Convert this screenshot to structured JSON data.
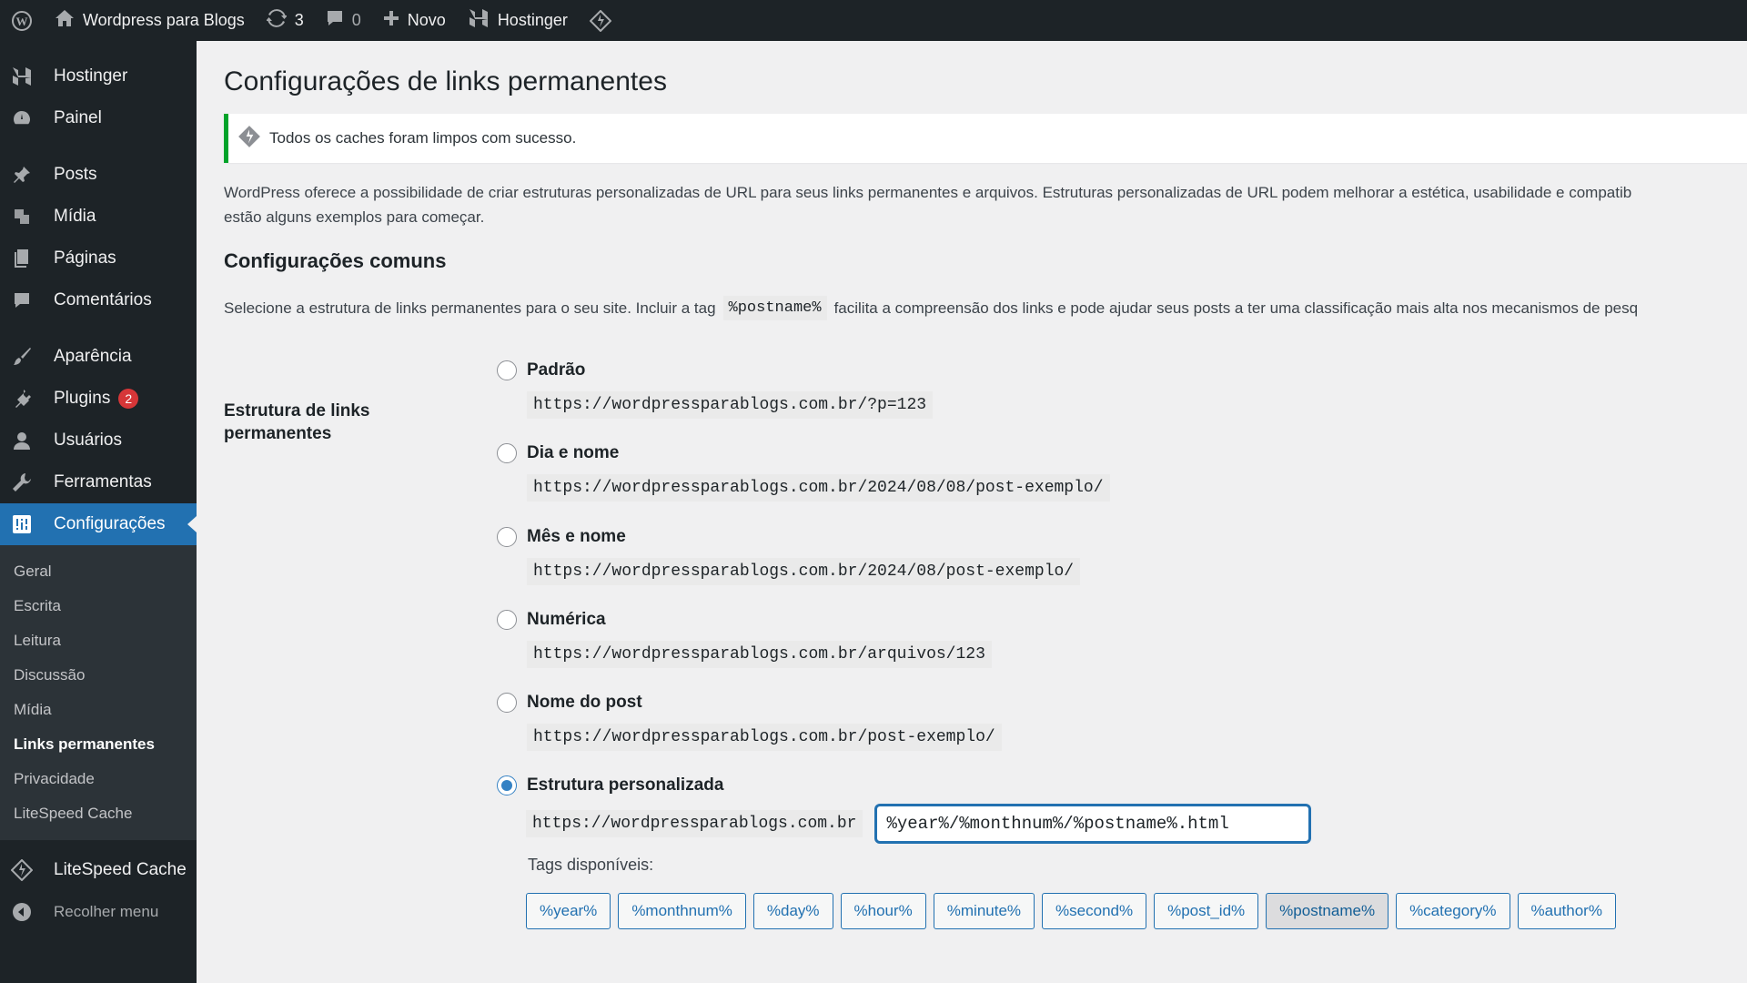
{
  "adminbar": {
    "site_name": "Wordpress para Blogs",
    "updates_count": "3",
    "comments_count": "0",
    "new_label": "Novo",
    "hostinger_label": "Hostinger"
  },
  "sidebar": {
    "items": [
      {
        "label": "Hostinger",
        "icon": "hostinger-icon"
      },
      {
        "label": "Painel",
        "icon": "dashboard-icon"
      },
      {
        "label": "Posts",
        "icon": "pin-icon"
      },
      {
        "label": "Mídia",
        "icon": "media-icon"
      },
      {
        "label": "Páginas",
        "icon": "page-icon"
      },
      {
        "label": "Comentários",
        "icon": "comment-icon"
      },
      {
        "label": "Aparência",
        "icon": "brush-icon"
      },
      {
        "label": "Plugins",
        "icon": "plugin-icon",
        "badge": "2"
      },
      {
        "label": "Usuários",
        "icon": "user-icon"
      },
      {
        "label": "Ferramentas",
        "icon": "wrench-icon"
      },
      {
        "label": "Configurações",
        "icon": "settings-icon"
      }
    ],
    "submenu": [
      "Geral",
      "Escrita",
      "Leitura",
      "Discussão",
      "Mídia",
      "Links permanentes",
      "Privacidade",
      "LiteSpeed Cache"
    ],
    "litespeed_label": "LiteSpeed Cache",
    "collapse_label": "Recolher menu"
  },
  "main": {
    "title": "Configurações de links permanentes",
    "notice": "Todos os caches foram limpos com sucesso.",
    "intro_line1": "WordPress oferece a possibilidade de criar estruturas personalizadas de URL para seus links permanentes e arquivos. Estruturas personalizadas de URL podem melhorar a estética, usabilidade e compatib",
    "intro_line2": "estão alguns exemplos para começar.",
    "section_title": "Configurações comuns",
    "desc_before": "Selecione a estrutura de links permanentes para o seu site. Incluir a tag",
    "desc_tag": "%postname%",
    "desc_after": "facilita a compreensão dos links e pode ajudar seus posts a ter uma classificação mais alta nos mecanismos de pesq",
    "row_label": "Estrutura de links permanentes",
    "options": [
      {
        "label": "Padrão",
        "example": "https://wordpressparablogs.com.br/?p=123"
      },
      {
        "label": "Dia e nome",
        "example": "https://wordpressparablogs.com.br/2024/08/08/post-exemplo/"
      },
      {
        "label": "Mês e nome",
        "example": "https://wordpressparablogs.com.br/2024/08/post-exemplo/"
      },
      {
        "label": "Numérica",
        "example": "https://wordpressparablogs.com.br/arquivos/123"
      },
      {
        "label": "Nome do post",
        "example": "https://wordpressparablogs.com.br/post-exemplo/"
      },
      {
        "label": "Estrutura personalizada",
        "example": "https://wordpressparablogs.com.br"
      }
    ],
    "custom_value": "%year%/%monthnum%/%postname%.html",
    "tags_label": "Tags disponíveis:",
    "tags": [
      "%year%",
      "%monthnum%",
      "%day%",
      "%hour%",
      "%minute%",
      "%second%",
      "%post_id%",
      "%postname%",
      "%category%",
      "%author%"
    ],
    "colors": {
      "accent": "#2271b1",
      "success": "#00a32a",
      "badge": "#d63638",
      "sidebar": "#1d2327"
    }
  }
}
